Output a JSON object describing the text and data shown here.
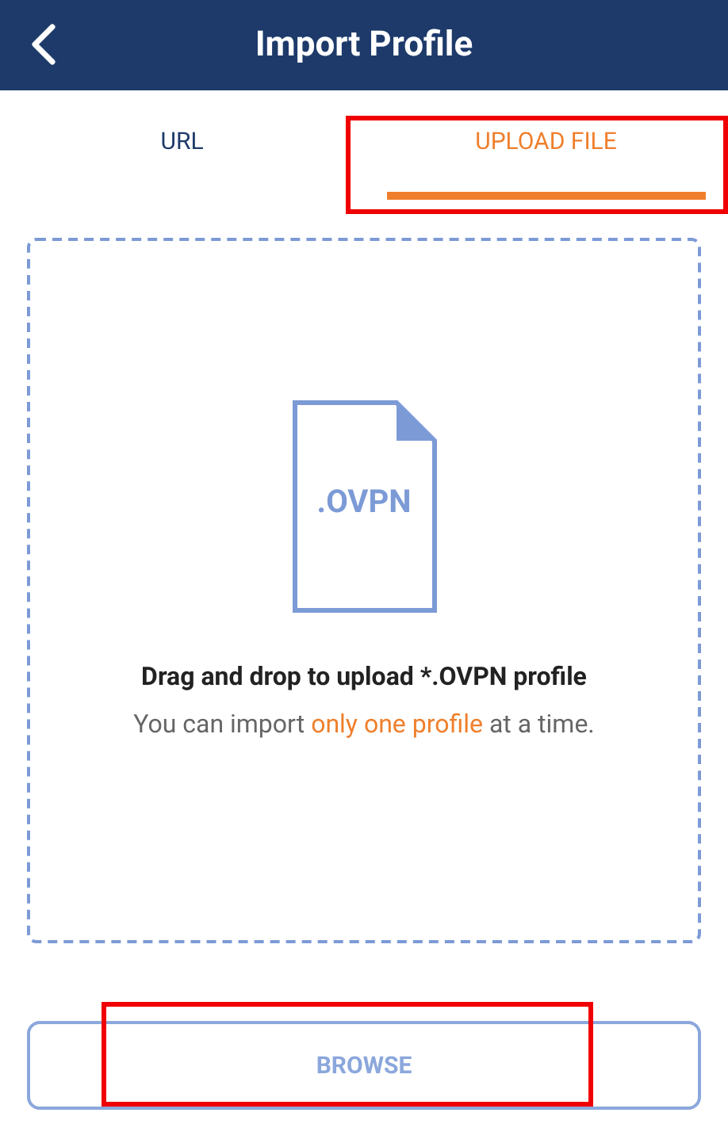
{
  "header": {
    "title": "Import Profile"
  },
  "tabs": [
    {
      "label": "URL",
      "selected": false
    },
    {
      "label": "UPLOAD FILE",
      "selected": true
    }
  ],
  "drop_zone": {
    "file_label": ".OVPN",
    "title": "Drag and drop to upload *.OVPN profile",
    "subtitle": [
      {
        "text": "You can import ",
        "highlight": false
      },
      {
        "text": "only one profile",
        "highlight": true
      },
      {
        "text": " at a time.",
        "highlight": false
      }
    ]
  },
  "browse_button": {
    "label": "BROWSE"
  }
}
